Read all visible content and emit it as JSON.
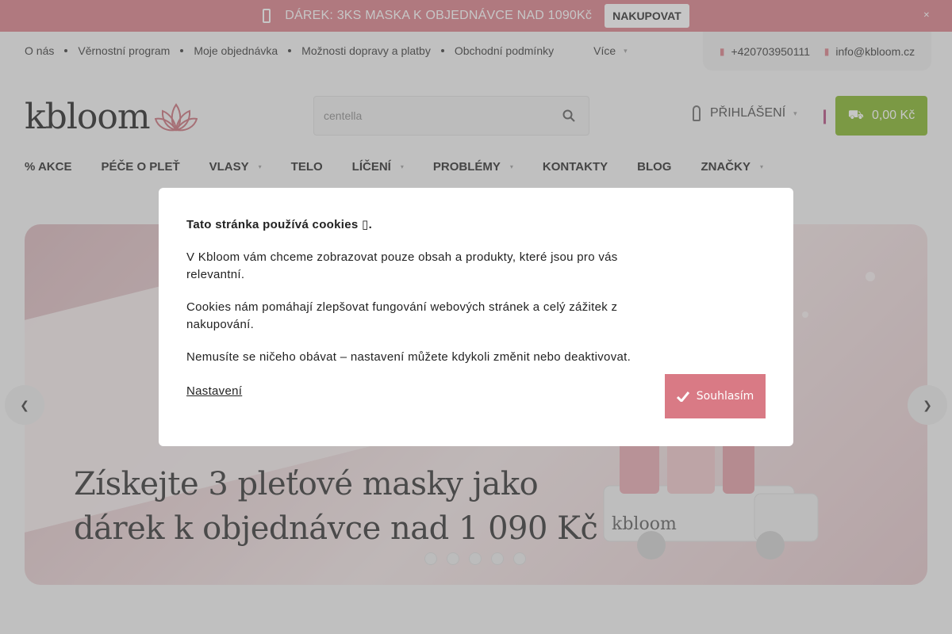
{
  "promo": {
    "text": "DÁREK: 3KS MASKA K OBJEDNÁVCE NAD 1090Kč",
    "button": "NAKUPOVAT",
    "gift_icon": "gift-icon",
    "close_icon": "close-icon"
  },
  "toplinks": {
    "items": [
      "O nás",
      "Věrnostní program",
      "Moje objednávka",
      "Možnosti dopravy a platby",
      "Obchodní podmínky"
    ],
    "more": "Více"
  },
  "contact": {
    "phone": "+420703950111",
    "email": "info@kbloom.cz"
  },
  "header": {
    "logo": "kbloom",
    "search_value": "centella",
    "login": "PŘIHLÁŠENÍ",
    "cart_total": "0,00 Kč"
  },
  "mainnav": {
    "items": [
      {
        "label": "% AKCE",
        "dropdown": false
      },
      {
        "label": "PÉČE O PLEŤ",
        "dropdown": false
      },
      {
        "label": "VLASY",
        "dropdown": true
      },
      {
        "label": "TELO",
        "dropdown": false
      },
      {
        "label": "LÍČENÍ",
        "dropdown": true
      },
      {
        "label": "PROBLÉMY",
        "dropdown": true
      },
      {
        "label": "KONTAKTY",
        "dropdown": false
      },
      {
        "label": "BLOG",
        "dropdown": false
      },
      {
        "label": "ZNAČKY",
        "dropdown": true
      }
    ]
  },
  "hero": {
    "title_line1": "Získejte 3 pleťové masky jako",
    "title_line2": "dárek k objednávce nad 1 090 Kč",
    "truck_brand": "kbloom",
    "slide_count": 5
  },
  "cookies": {
    "title": "Tato stránka používá cookies",
    "title_suffix": ".",
    "p1": "V Kbloom vám chceme zobrazovat pouze obsah a produkty, které jsou pro vás relevantní.",
    "p2": "Cookies nám pomáhají zlepšovat fungování webových stránek a celý zážitek z nakupování.",
    "p3": "Nemusíte se ničeho obávat – nastavení můžete kdykoli změnit nebo deaktivovat.",
    "settings_link": "Nastavení",
    "accept": "Souhlasím"
  },
  "colors": {
    "accent_pink": "#d97a85",
    "cart_green": "#7fb21f",
    "favorite_magenta": "#b0457a"
  }
}
